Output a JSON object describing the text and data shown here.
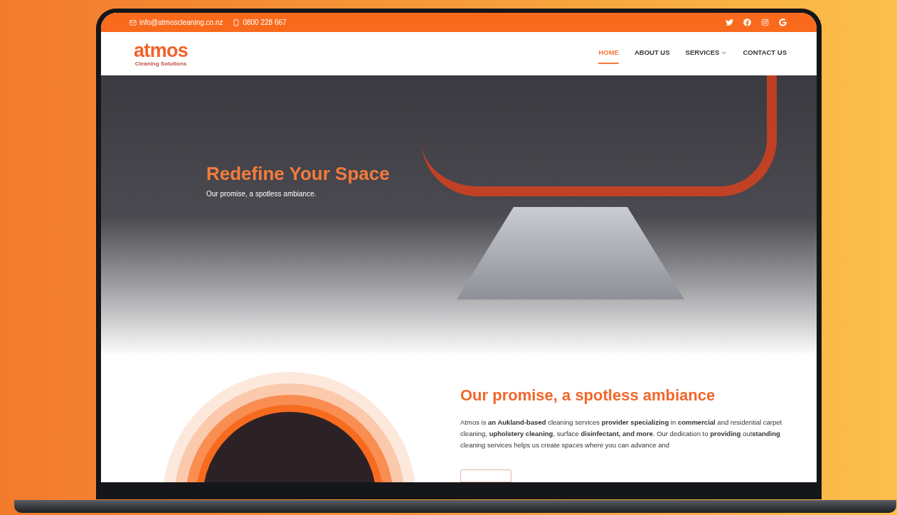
{
  "topbar": {
    "email": "info@atmoscleaning.co.nz",
    "phone": "0800 228 667"
  },
  "logo": {
    "name": "atmos",
    "tagline": "Cleaning Solutions"
  },
  "nav": [
    {
      "label": "HOME",
      "selected": true,
      "dropdown": false
    },
    {
      "label": "ABOUT US",
      "selected": false,
      "dropdown": false
    },
    {
      "label": "SERVICES",
      "selected": false,
      "dropdown": true
    },
    {
      "label": "CONTACT US",
      "selected": false,
      "dropdown": false
    }
  ],
  "hero": {
    "title": "Redefine Your Space",
    "subtitle": "Our promise, a spotless ambiance."
  },
  "about": {
    "heading": "Our promise, a spotless ambiance",
    "paragraph": "Atmos is **an Aukland-based** cleaning services **provider specializing** in **commercial** and residential carpet cleaning, **upholstery cleaning**, surface **disinfectant, and more**. Our dedication to **providing** out**standing** cleaning services helps us create spaces where you can advance and"
  }
}
